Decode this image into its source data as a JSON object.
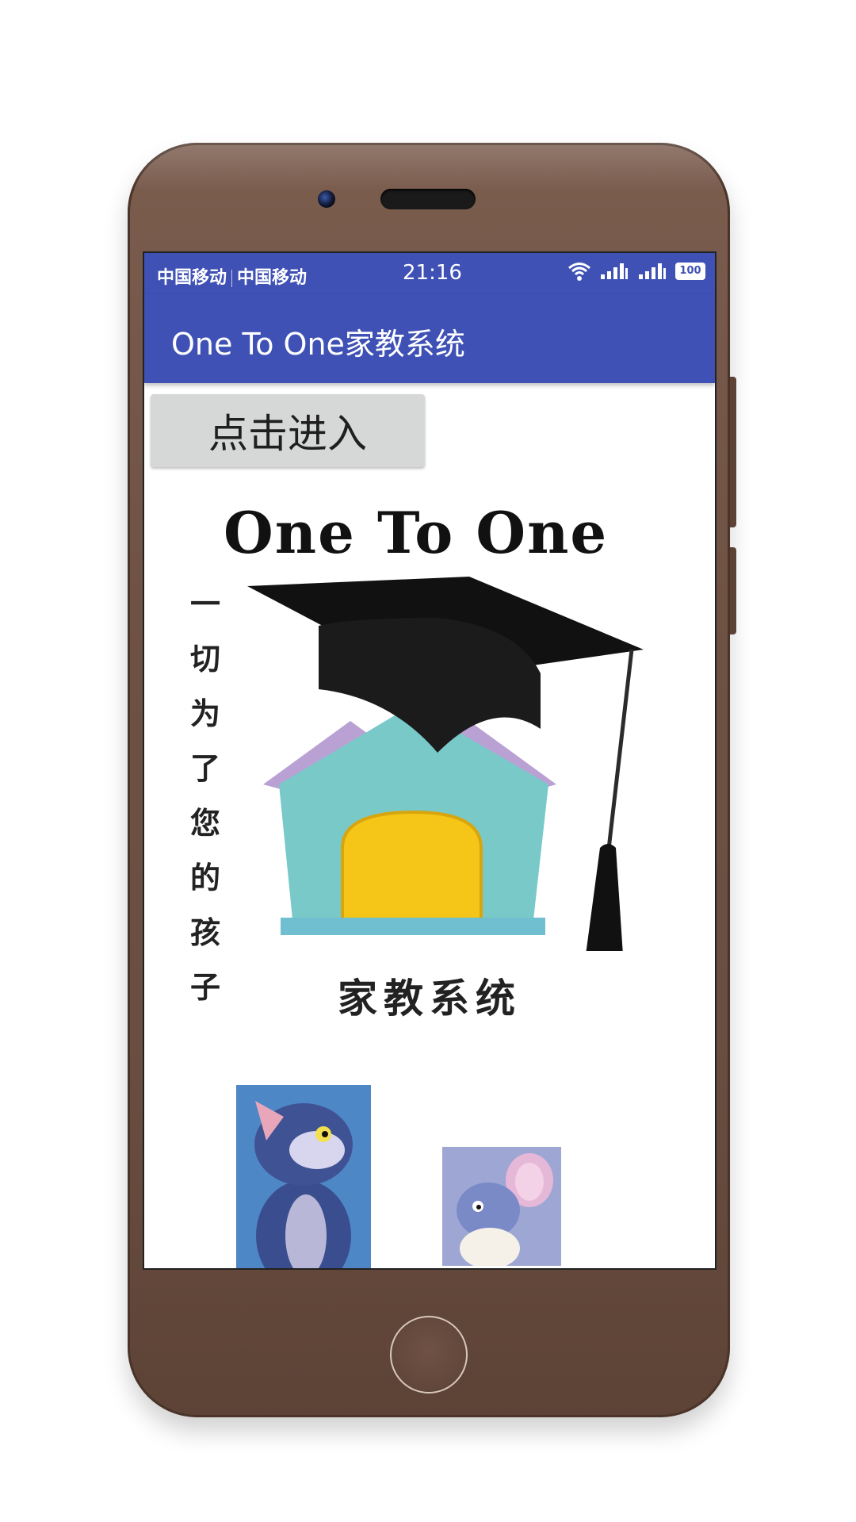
{
  "status_bar": {
    "carrier_1": "中国移动",
    "carrier_2": "中国移动",
    "time": "21:16",
    "battery": "100",
    "icons": [
      "wifi-icon",
      "signal-icon",
      "signal-icon",
      "battery-icon"
    ]
  },
  "app_bar": {
    "title": "One To One家教系统",
    "color": "#3f51b5"
  },
  "main": {
    "enter_button_label": "点击进入",
    "logo": {
      "title": "One To One",
      "slogan": [
        "一",
        "切",
        "为",
        "了",
        "您",
        "的",
        "孩",
        "子"
      ],
      "subtitle": "家教系统",
      "image_icons": [
        "graduation-cap-icon",
        "house-icon"
      ]
    },
    "cartoons": [
      "cat-cartoon-image",
      "mouse-cartoon-image"
    ]
  },
  "device": {
    "color": "#6d5143"
  }
}
